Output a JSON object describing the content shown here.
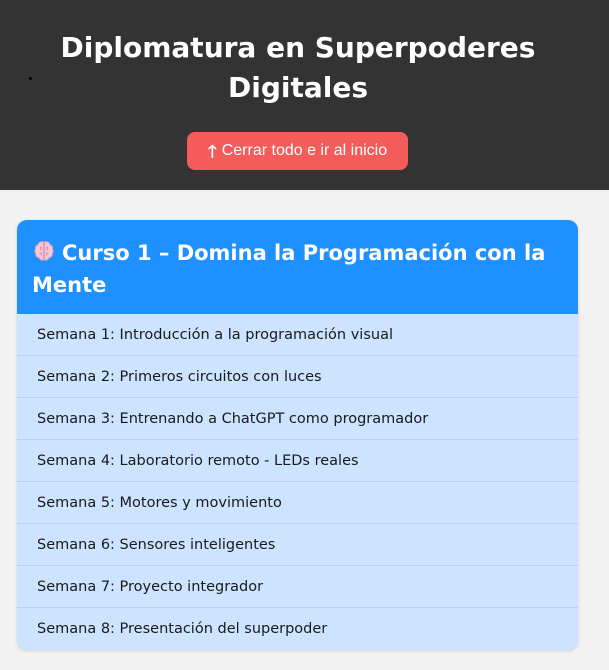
{
  "header": {
    "title": "Diplomatura en Superpoderes Digitales",
    "close_button": {
      "icon": "arrow-up-icon",
      "icon_glyph": "🡑",
      "label": "Cerrar todo e ir al inicio"
    }
  },
  "course": {
    "icon": "brain-icon",
    "title": "Curso 1 – Domina la Programación con la Mente",
    "weeks": [
      "Semana 1: Introducción a la programación visual",
      "Semana 2: Primeros circuitos con luces",
      "Semana 3: Entrenando a ChatGPT como programador",
      "Semana 4: Laboratorio remoto - LEDs reales",
      "Semana 5: Motores y movimiento",
      "Semana 6: Sensores inteligentes",
      "Semana 7: Proyecto integrador",
      "Semana 8: Presentación del superpoder"
    ]
  },
  "colors": {
    "header_bg": "#333333",
    "button_bg": "#f45b5b",
    "card_header_bg": "#1e90ff",
    "card_body_bg": "#cce4ff",
    "page_bg": "#f2f2f2"
  }
}
